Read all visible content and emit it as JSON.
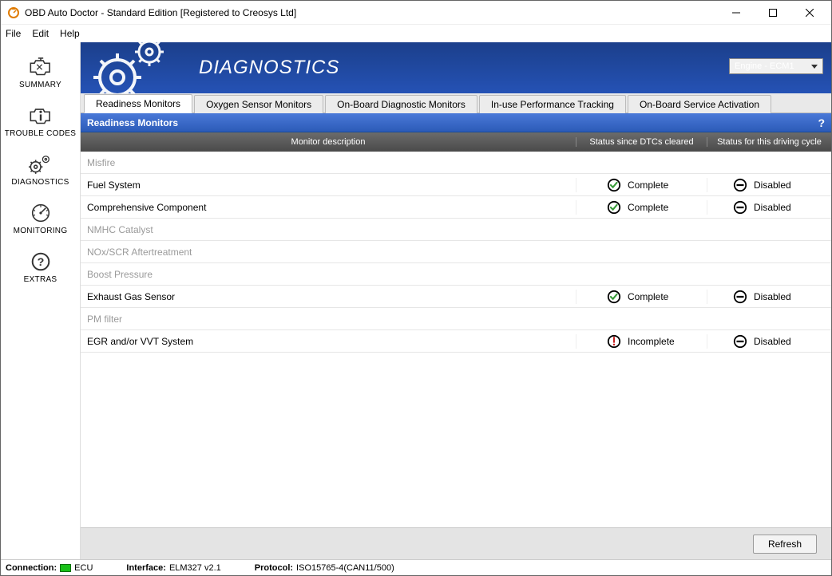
{
  "window": {
    "title": "OBD Auto Doctor - Standard Edition [Registered to Creosys Ltd]"
  },
  "menu": {
    "file": "File",
    "edit": "Edit",
    "help": "Help"
  },
  "sidebar": {
    "summary": "SUMMARY",
    "trouble": "TROUBLE CODES",
    "diagnostics": "DIAGNOSTICS",
    "monitoring": "MONITORING",
    "extras": "EXTRAS"
  },
  "banner": {
    "title": "DIAGNOSTICS",
    "ecu_selected": "Engine - ECM1"
  },
  "tabs": {
    "readiness": "Readiness Monitors",
    "oxygen": "Oxygen Sensor Monitors",
    "onboard": "On-Board Diagnostic Monitors",
    "inuse": "In-use Performance Tracking",
    "service": "On-Board Service Activation"
  },
  "section": {
    "title": "Readiness Monitors",
    "help": "?"
  },
  "columns": {
    "desc": "Monitor description",
    "status1": "Status since DTCs cleared",
    "status2": "Status for this driving cycle"
  },
  "rows": {
    "r0": {
      "desc": "Misfire"
    },
    "r1": {
      "desc": "Fuel System",
      "s1": "Complete",
      "s2": "Disabled"
    },
    "r2": {
      "desc": "Comprehensive Component",
      "s1": "Complete",
      "s2": "Disabled"
    },
    "r3": {
      "desc": "NMHC Catalyst"
    },
    "r4": {
      "desc": "NOx/SCR Aftertreatment"
    },
    "r5": {
      "desc": "Boost Pressure"
    },
    "r6": {
      "desc": "Exhaust Gas Sensor",
      "s1": "Complete",
      "s2": "Disabled"
    },
    "r7": {
      "desc": "PM filter"
    },
    "r8": {
      "desc": "EGR and/or VVT System",
      "s1": "Incomplete",
      "s2": "Disabled"
    }
  },
  "buttons": {
    "refresh": "Refresh"
  },
  "status": {
    "conn_label": "Connection:",
    "conn_value": "ECU",
    "iface_label": "Interface:",
    "iface_value": "ELM327 v2.1",
    "proto_label": "Protocol:",
    "proto_value": "ISO15765-4(CAN11/500)"
  }
}
